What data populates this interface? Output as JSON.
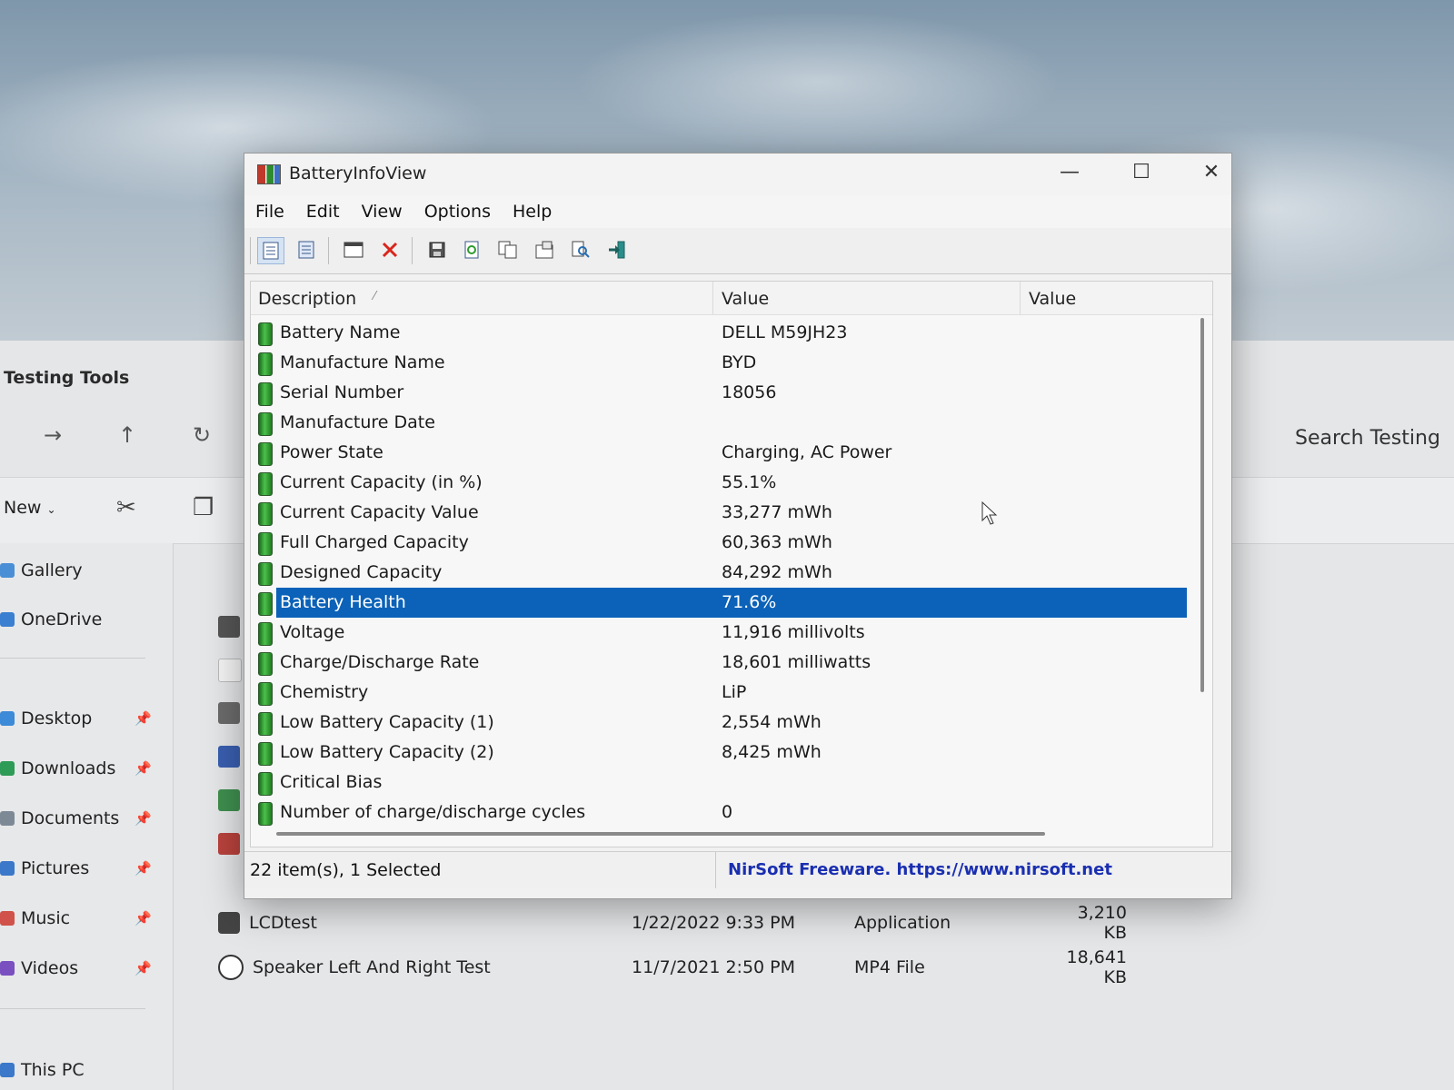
{
  "explorer": {
    "title": "Testing Tools",
    "search_label": "Search Testing",
    "new_label": "New",
    "sidebar": [
      {
        "label": "Gallery",
        "color": "#4a8fd6"
      },
      {
        "label": "OneDrive",
        "color": "#3b7fd1"
      },
      {
        "label": "Desktop",
        "color": "#3c8ad8"
      },
      {
        "label": "Downloads",
        "color": "#2e9b57"
      },
      {
        "label": "Documents",
        "color": "#7d8a96"
      },
      {
        "label": "Pictures",
        "color": "#3b78c9"
      },
      {
        "label": "Music",
        "color": "#d0524a"
      },
      {
        "label": "Videos",
        "color": "#7a4fc0"
      },
      {
        "label": "This PC",
        "color": "#3b78c9"
      }
    ],
    "files": [
      {
        "name": "LCDtest",
        "date": "1/22/2022 9:33 PM",
        "type": "Application",
        "size": "3,210 KB"
      },
      {
        "name": "Speaker Left And Right Test",
        "date": "11/7/2021 2:50 PM",
        "type": "MP4 File",
        "size": "18,641 KB"
      }
    ]
  },
  "window": {
    "title": "BatteryInfoView",
    "menu": [
      "File",
      "Edit",
      "View",
      "Options",
      "Help"
    ],
    "columns": [
      "Description",
      "Value",
      "Value"
    ],
    "rows": [
      {
        "description": "Battery Name",
        "value": "DELL M59JH23"
      },
      {
        "description": "Manufacture Name",
        "value": "BYD"
      },
      {
        "description": "Serial Number",
        "value": "18056"
      },
      {
        "description": "Manufacture Date",
        "value": ""
      },
      {
        "description": "Power State",
        "value": "Charging, AC Power"
      },
      {
        "description": "Current Capacity (in %)",
        "value": "55.1%"
      },
      {
        "description": "Current Capacity Value",
        "value": "33,277 mWh"
      },
      {
        "description": "Full Charged Capacity",
        "value": "60,363 mWh"
      },
      {
        "description": "Designed Capacity",
        "value": "84,292 mWh"
      },
      {
        "description": "Battery Health",
        "value": "71.6%",
        "selected": true
      },
      {
        "description": "Voltage",
        "value": "11,916 millivolts"
      },
      {
        "description": "Charge/Discharge Rate",
        "value": "18,601 milliwatts"
      },
      {
        "description": "Chemistry",
        "value": "LiP"
      },
      {
        "description": "Low Battery Capacity (1)",
        "value": "2,554 mWh"
      },
      {
        "description": "Low Battery Capacity (2)",
        "value": "8,425 mWh"
      },
      {
        "description": "Critical Bias",
        "value": ""
      },
      {
        "description": "Number of charge/discharge cycles",
        "value": "0"
      }
    ],
    "status": {
      "items": "22 item(s), 1 Selected",
      "link": "NirSoft Freeware. https://www.nirsoft.net"
    },
    "selection_color": "#0b62b8",
    "link_color": "#1a2fb0"
  }
}
